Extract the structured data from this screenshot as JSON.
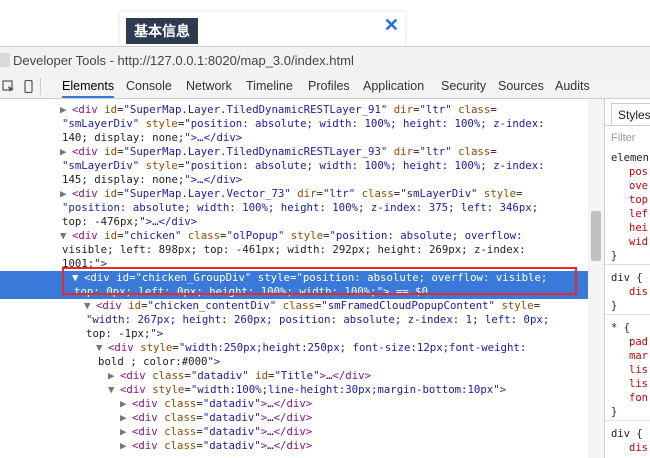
{
  "popup": {
    "title": "基本信息",
    "close_icon": "close-icon",
    "close_glyph": "✕",
    "accent": "#1f6fcf"
  },
  "window": {
    "title": "Developer Tools - http://127.0.0.1:8020/map_3.0/index.html"
  },
  "toolbar": {
    "tabs": [
      "Elements",
      "Console",
      "Network",
      "Timeline",
      "Profiles",
      "Application",
      "Security",
      "Sources",
      "Audits"
    ],
    "active_tab": "Elements",
    "icons": [
      "inspect-icon",
      "device-icon"
    ]
  },
  "elements_panel": {
    "lines": [
      [
        "▶ ",
        "<div id=\"SuperMap.Layer.TiledDynamicRESTLayer_91\" dir=\"ltr\" class="
      ],
      [
        "",
        "\"smLayerDiv\" style=\"position: absolute; width: 100%; height: 100%; z-index:"
      ],
      [
        "",
        "140; display: none;\">…</div>"
      ],
      [
        "▶ ",
        "<div id=\"SuperMap.Layer.TiledDynamicRESTLayer_93\" dir=\"ltr\" class="
      ],
      [
        "",
        "\"smLayerDiv\" style=\"position: absolute; width: 100%; height: 100%; z-index:"
      ],
      [
        "",
        "145; display: none;\">…</div>"
      ],
      [
        "▶ ",
        "<div id=\"SuperMap.Layer.Vector_73\" dir=\"ltr\" class=\"smLayerDiv\" style="
      ],
      [
        "",
        "\"position: absolute; width: 100%; height: 100%; z-index: 375; left: 346px;"
      ],
      [
        "",
        "top: -476px;\">…</div>"
      ],
      [
        "▼ ",
        "<div id=\"chicken\" class=\"olPopup\" style=\"position: absolute; overflow:"
      ],
      [
        "",
        "visible; left: 898px; top: -461px; width: 292px; height: 269px; z-index:"
      ],
      [
        "",
        "1001;\">"
      ],
      [
        "▼ ",
        "<div id=\"chicken_GroupDiv\" style=\"position: absolute; overflow: visible;"
      ],
      [
        "",
        "top: 0px; left: 0px; height: 100%; width: 100%;\"> == $0"
      ],
      [
        "▼ ",
        "<div id=\"chicken_contentDiv\" class=\"smFramedCloudPopupContent\" style="
      ],
      [
        "",
        "\"width: 267px; height: 260px; position: absolute; z-index: 1; left: 0px;"
      ],
      [
        "",
        "top: -1px;\">"
      ],
      [
        "▼ ",
        "<div style=\"width:250px;height:250px; font-size:12px;font-weight:"
      ],
      [
        "",
        "bold ; color:#000\">"
      ],
      [
        "▶ ",
        "<div class=\"datadiv\" id=\"Title\">…</div>"
      ],
      [
        "▼ ",
        "<div style=\"width:100%;line-height:30px;margin-bottom:10px\">"
      ],
      [
        "▶ ",
        "<div class=\"datadiv\">…</div>"
      ],
      [
        "▶ ",
        "<div class=\"datadiv\">…</div>"
      ],
      [
        "▶ ",
        "<div class=\"datadiv\">…</div>"
      ],
      [
        "▶ ",
        "<div class=\"datadiv\">…</div>"
      ]
    ],
    "selected_index": 12,
    "selection_color": "#3879d9",
    "highlight_color": "#e8292b"
  },
  "styles_pane": {
    "tab_label": "Styles",
    "filter_placeholder": "Filter",
    "lines": [
      "elemen",
      "pos",
      "ove",
      "top",
      "lef",
      "hei",
      "wid",
      "}",
      "div {",
      "dis",
      "}",
      "* {",
      "pad",
      "mar",
      "lis",
      "lis",
      "fon",
      "}",
      "div {",
      "dis"
    ]
  }
}
